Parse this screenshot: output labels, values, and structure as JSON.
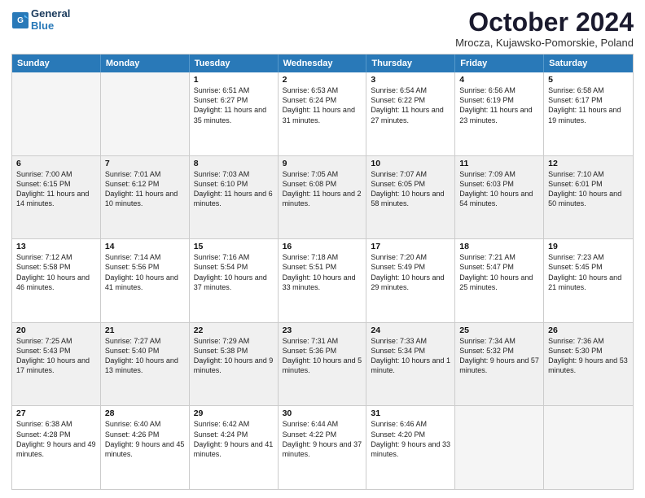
{
  "header": {
    "logo_line1": "General",
    "logo_line2": "Blue",
    "month_title": "October 2024",
    "location": "Mrocza, Kujawsko-Pomorskie, Poland"
  },
  "days_of_week": [
    "Sunday",
    "Monday",
    "Tuesday",
    "Wednesday",
    "Thursday",
    "Friday",
    "Saturday"
  ],
  "rows": [
    [
      {
        "day": "",
        "text": "",
        "empty": true
      },
      {
        "day": "",
        "text": "",
        "empty": true
      },
      {
        "day": "1",
        "text": "Sunrise: 6:51 AM\nSunset: 6:27 PM\nDaylight: 11 hours and 35 minutes."
      },
      {
        "day": "2",
        "text": "Sunrise: 6:53 AM\nSunset: 6:24 PM\nDaylight: 11 hours and 31 minutes."
      },
      {
        "day": "3",
        "text": "Sunrise: 6:54 AM\nSunset: 6:22 PM\nDaylight: 11 hours and 27 minutes."
      },
      {
        "day": "4",
        "text": "Sunrise: 6:56 AM\nSunset: 6:19 PM\nDaylight: 11 hours and 23 minutes."
      },
      {
        "day": "5",
        "text": "Sunrise: 6:58 AM\nSunset: 6:17 PM\nDaylight: 11 hours and 19 minutes."
      }
    ],
    [
      {
        "day": "6",
        "text": "Sunrise: 7:00 AM\nSunset: 6:15 PM\nDaylight: 11 hours and 14 minutes."
      },
      {
        "day": "7",
        "text": "Sunrise: 7:01 AM\nSunset: 6:12 PM\nDaylight: 11 hours and 10 minutes."
      },
      {
        "day": "8",
        "text": "Sunrise: 7:03 AM\nSunset: 6:10 PM\nDaylight: 11 hours and 6 minutes."
      },
      {
        "day": "9",
        "text": "Sunrise: 7:05 AM\nSunset: 6:08 PM\nDaylight: 11 hours and 2 minutes."
      },
      {
        "day": "10",
        "text": "Sunrise: 7:07 AM\nSunset: 6:05 PM\nDaylight: 10 hours and 58 minutes."
      },
      {
        "day": "11",
        "text": "Sunrise: 7:09 AM\nSunset: 6:03 PM\nDaylight: 10 hours and 54 minutes."
      },
      {
        "day": "12",
        "text": "Sunrise: 7:10 AM\nSunset: 6:01 PM\nDaylight: 10 hours and 50 minutes."
      }
    ],
    [
      {
        "day": "13",
        "text": "Sunrise: 7:12 AM\nSunset: 5:58 PM\nDaylight: 10 hours and 46 minutes."
      },
      {
        "day": "14",
        "text": "Sunrise: 7:14 AM\nSunset: 5:56 PM\nDaylight: 10 hours and 41 minutes."
      },
      {
        "day": "15",
        "text": "Sunrise: 7:16 AM\nSunset: 5:54 PM\nDaylight: 10 hours and 37 minutes."
      },
      {
        "day": "16",
        "text": "Sunrise: 7:18 AM\nSunset: 5:51 PM\nDaylight: 10 hours and 33 minutes."
      },
      {
        "day": "17",
        "text": "Sunrise: 7:20 AM\nSunset: 5:49 PM\nDaylight: 10 hours and 29 minutes."
      },
      {
        "day": "18",
        "text": "Sunrise: 7:21 AM\nSunset: 5:47 PM\nDaylight: 10 hours and 25 minutes."
      },
      {
        "day": "19",
        "text": "Sunrise: 7:23 AM\nSunset: 5:45 PM\nDaylight: 10 hours and 21 minutes."
      }
    ],
    [
      {
        "day": "20",
        "text": "Sunrise: 7:25 AM\nSunset: 5:43 PM\nDaylight: 10 hours and 17 minutes."
      },
      {
        "day": "21",
        "text": "Sunrise: 7:27 AM\nSunset: 5:40 PM\nDaylight: 10 hours and 13 minutes."
      },
      {
        "day": "22",
        "text": "Sunrise: 7:29 AM\nSunset: 5:38 PM\nDaylight: 10 hours and 9 minutes."
      },
      {
        "day": "23",
        "text": "Sunrise: 7:31 AM\nSunset: 5:36 PM\nDaylight: 10 hours and 5 minutes."
      },
      {
        "day": "24",
        "text": "Sunrise: 7:33 AM\nSunset: 5:34 PM\nDaylight: 10 hours and 1 minute."
      },
      {
        "day": "25",
        "text": "Sunrise: 7:34 AM\nSunset: 5:32 PM\nDaylight: 9 hours and 57 minutes."
      },
      {
        "day": "26",
        "text": "Sunrise: 7:36 AM\nSunset: 5:30 PM\nDaylight: 9 hours and 53 minutes."
      }
    ],
    [
      {
        "day": "27",
        "text": "Sunrise: 6:38 AM\nSunset: 4:28 PM\nDaylight: 9 hours and 49 minutes."
      },
      {
        "day": "28",
        "text": "Sunrise: 6:40 AM\nSunset: 4:26 PM\nDaylight: 9 hours and 45 minutes."
      },
      {
        "day": "29",
        "text": "Sunrise: 6:42 AM\nSunset: 4:24 PM\nDaylight: 9 hours and 41 minutes."
      },
      {
        "day": "30",
        "text": "Sunrise: 6:44 AM\nSunset: 4:22 PM\nDaylight: 9 hours and 37 minutes."
      },
      {
        "day": "31",
        "text": "Sunrise: 6:46 AM\nSunset: 4:20 PM\nDaylight: 9 hours and 33 minutes."
      },
      {
        "day": "",
        "text": "",
        "empty": true
      },
      {
        "day": "",
        "text": "",
        "empty": true
      }
    ]
  ]
}
